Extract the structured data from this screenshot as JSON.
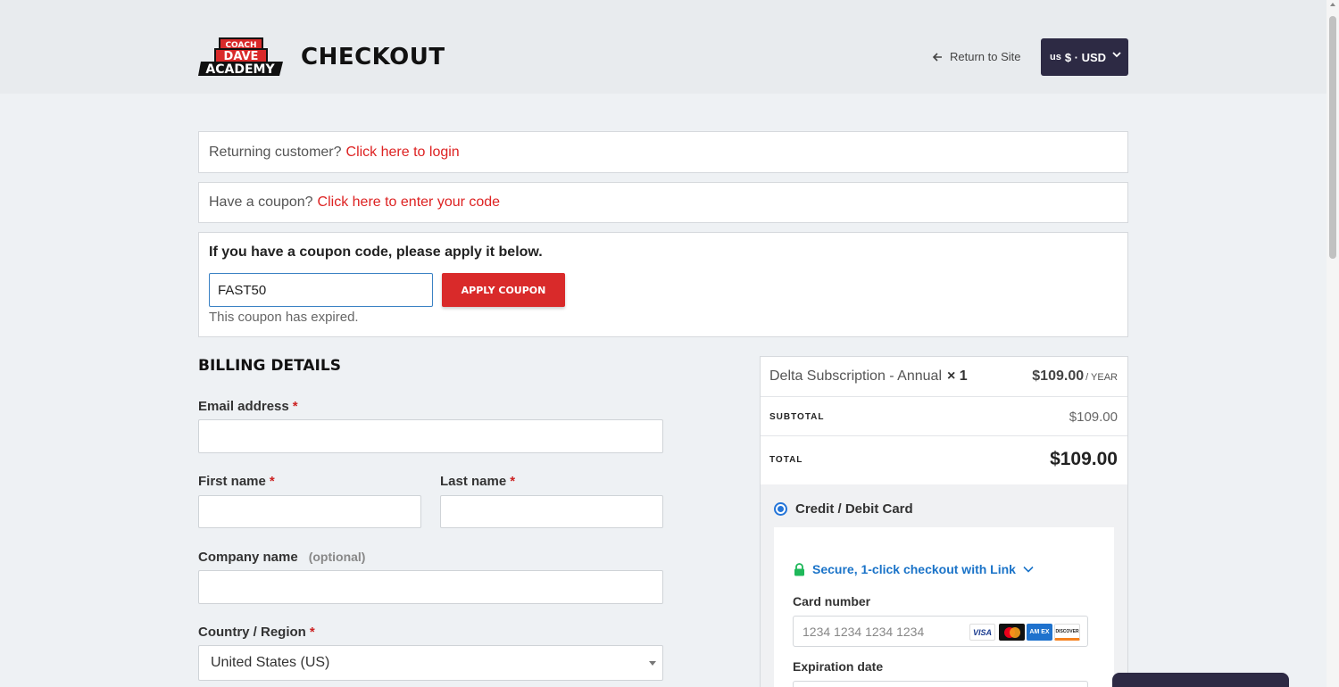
{
  "header": {
    "logo": {
      "line1": "COACH",
      "line2": "DAVE",
      "line3": "ACADEMY"
    },
    "title": "CHECKOUT",
    "return_label": "Return to Site",
    "currency": {
      "flag": "us",
      "label": "$ · USD"
    }
  },
  "notices": {
    "login_prefix": "Returning customer?",
    "login_link": "Click here to login",
    "coupon_prefix": "Have a coupon?",
    "coupon_link": "Click here to enter your code"
  },
  "coupon": {
    "heading": "If you have a coupon code, please apply it below.",
    "code_value": "FAST50",
    "apply_label": "APPLY COUPON",
    "error": "This coupon has expired."
  },
  "billing": {
    "title": "BILLING DETAILS",
    "email_label": "Email address",
    "first_name_label": "First name",
    "last_name_label": "Last name",
    "company_label": "Company name",
    "optional_label": "(optional)",
    "country_label": "Country / Region",
    "country_value": "United States (US)",
    "required_mark": "*"
  },
  "order": {
    "item_name": "Delta Subscription - Annual",
    "item_qty": "× 1",
    "item_price": "$109.00",
    "item_period": "/ YEAR",
    "subtotal_label": "SUBTOTAL",
    "subtotal_value": "$109.00",
    "total_label": "TOTAL",
    "total_value": "$109.00"
  },
  "payment": {
    "method_label": "Credit / Debit Card",
    "link_label": "Secure, 1-click checkout with Link",
    "card_number_label": "Card number",
    "card_number_placeholder": "1234 1234 1234 1234",
    "brands": {
      "visa": "VISA",
      "amex": "AM EX",
      "discover": "DISCOVER"
    },
    "expiration_label": "Expiration date"
  },
  "colors": {
    "accent_red": "#d92a2a",
    "dark_navy": "#2d2a44",
    "link_blue": "#1a73c8",
    "secure_green": "#1fb85a"
  },
  "icons": [
    "arrow-left-icon",
    "chevron-down-icon",
    "lock-icon",
    "visa-icon",
    "mastercard-icon",
    "amex-icon",
    "discover-icon"
  ]
}
